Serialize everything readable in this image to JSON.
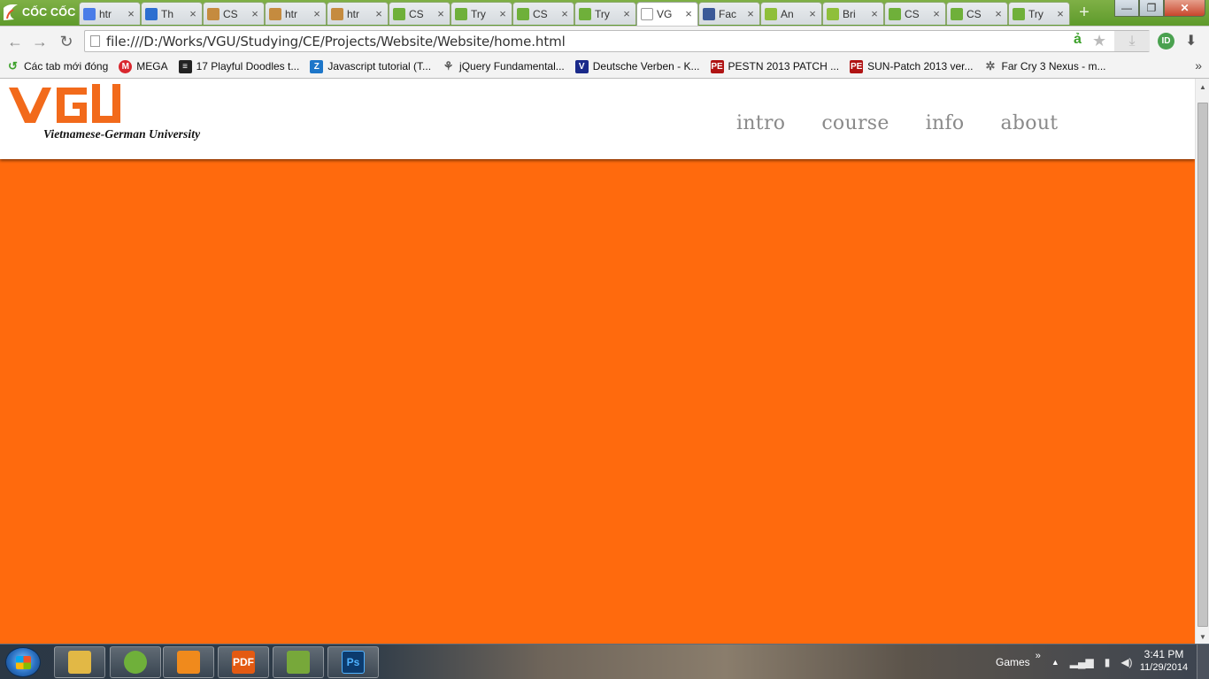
{
  "browser": {
    "brand": "CỐC CỐC",
    "tabs": [
      {
        "title": "htr",
        "icon": "google-icon",
        "color": "#4a7ce8"
      },
      {
        "title": "Th",
        "icon": "braces-icon",
        "color": "#2d6fd0"
      },
      {
        "title": "CS",
        "icon": "stackoverflow-icon",
        "color": "#c58b3f"
      },
      {
        "title": "htr",
        "icon": "stackoverflow-icon",
        "color": "#c58b3f"
      },
      {
        "title": "htr",
        "icon": "stackoverflow-icon",
        "color": "#c58b3f"
      },
      {
        "title": "CS",
        "icon": "w3schools-icon",
        "color": "#6fb03a"
      },
      {
        "title": "Try",
        "icon": "w3schools-icon",
        "color": "#6fb03a"
      },
      {
        "title": "CS",
        "icon": "w3schools-icon",
        "color": "#6fb03a"
      },
      {
        "title": "Try",
        "icon": "w3schools-icon",
        "color": "#6fb03a"
      },
      {
        "title": "VG",
        "icon": "page-icon",
        "color": "#ffffff",
        "active": true
      },
      {
        "title": "Fac",
        "icon": "facebook-icon",
        "color": "#3b5998"
      },
      {
        "title": "An",
        "icon": "android-icon",
        "color": "#8fbf3a"
      },
      {
        "title": "Bri",
        "icon": "android-icon",
        "color": "#8fbf3a"
      },
      {
        "title": "CS",
        "icon": "w3schools-icon",
        "color": "#6fb03a"
      },
      {
        "title": "CS",
        "icon": "w3schools-icon",
        "color": "#6fb03a"
      },
      {
        "title": "Try",
        "icon": "w3schools-icon",
        "color": "#6fb03a"
      }
    ],
    "tab_close_glyph": "×",
    "new_tab_glyph": "+",
    "window_controls": {
      "minimize": "—",
      "maximize": "❐",
      "close": "✕"
    },
    "address_bar": {
      "url": "file:///D:/Works/VGU/Studying/CE/Projects/Website/Website/home.html"
    },
    "extension_badge": "ID",
    "bookmarks": [
      {
        "label": "Các tab mới đóng",
        "icon": "recent-tabs-icon",
        "color": "#3da12b",
        "glyph": "↺"
      },
      {
        "label": "MEGA",
        "icon": "mega-icon",
        "color": "#d9272e",
        "glyph": "M"
      },
      {
        "label": "17 Playful Doodles t...",
        "icon": "doodle-icon",
        "color": "#222222",
        "glyph": "≡"
      },
      {
        "label": "Javascript tutorial (T...",
        "icon": "zing-icon",
        "color": "#1d76c9",
        "glyph": "Z"
      },
      {
        "label": "jQuery Fundamental...",
        "icon": "jquery-icon",
        "color": "#555555",
        "glyph": "⚘"
      },
      {
        "label": "Deutsche Verben - K...",
        "icon": "verben-icon",
        "color": "#1a2a8a",
        "glyph": "V"
      },
      {
        "label": "PESTN 2013 PATCH ...",
        "icon": "pe-icon",
        "color": "#b01414",
        "glyph": "PE"
      },
      {
        "label": "SUN-Patch 2013 ver...",
        "icon": "pe-icon",
        "color": "#b01414",
        "glyph": "PE"
      },
      {
        "label": "Far Cry 3 Nexus - m...",
        "icon": "nexus-icon",
        "color": "#666666",
        "glyph": "✲"
      }
    ],
    "bookmarks_more": "»"
  },
  "page": {
    "logo_text": "VGU",
    "tagline": "Vietnamese-German University",
    "nav": [
      "intro",
      "course",
      "info",
      "about"
    ],
    "colors": {
      "accent": "#ff6a0d",
      "nav_text": "#8a8a8a"
    }
  },
  "taskbar": {
    "apps": [
      {
        "name": "file-explorer-icon",
        "color": "#e2b845"
      },
      {
        "name": "coccoc-icon",
        "color": "#6fb03a"
      },
      {
        "name": "media-player-icon",
        "color": "#f08a1c"
      },
      {
        "name": "pdf-icon",
        "color": "#e45a12"
      },
      {
        "name": "notepadpp-icon",
        "color": "#77a83a"
      },
      {
        "name": "photoshop-icon",
        "color": "#0c3b6e"
      }
    ],
    "app_labels": [
      "",
      "",
      "",
      "PDF",
      "",
      "Ps"
    ],
    "tray_label": "Games",
    "tray_chevron": "»",
    "clock_time": "3:41 PM",
    "clock_date": "11/29/2014"
  }
}
